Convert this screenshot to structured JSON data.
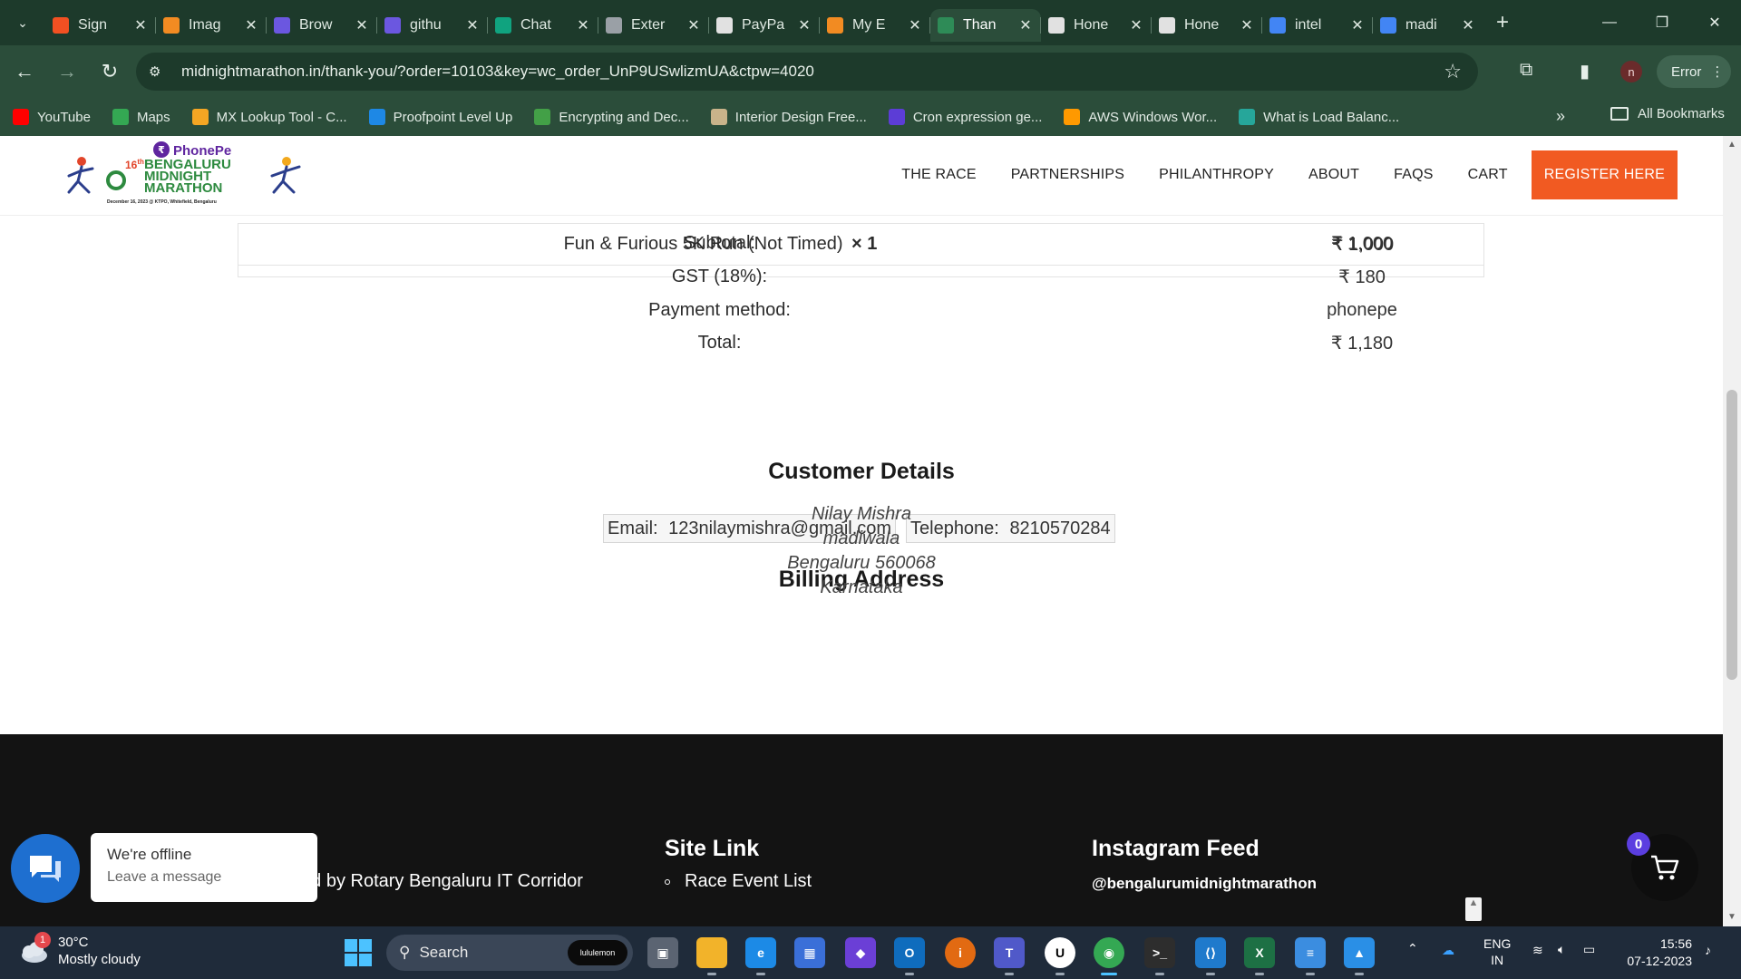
{
  "browser": {
    "tabs": [
      {
        "label": "Sign",
        "color": "#f25022"
      },
      {
        "label": "Imag",
        "color": "#f28b22"
      },
      {
        "label": "Brow",
        "color": "#6b57e0"
      },
      {
        "label": "githu",
        "color": "#6b57e0"
      },
      {
        "label": "Chat",
        "color": "#10a37f"
      },
      {
        "label": "Exter",
        "color": "#9aa0a6"
      },
      {
        "label": "PayPa",
        "color": "#e1e1e1"
      },
      {
        "label": "My E",
        "color": "#f28b22"
      },
      {
        "label": "Than",
        "color": "#2e8b57"
      },
      {
        "label": "Hone",
        "color": "#e1e1e1"
      },
      {
        "label": "Hone",
        "color": "#e1e1e1"
      },
      {
        "label": "intel",
        "color": "#4285f4"
      },
      {
        "label": "madi",
        "color": "#4285f4"
      }
    ],
    "url": "midnightmarathon.in/thank-you/?order=10103&key=wc_order_UnP9USwlizmUA&ctpw=4020",
    "profile_initial": "n",
    "error_label": "Error",
    "bookmarks": [
      {
        "label": "YouTube",
        "color": "#ff0000"
      },
      {
        "label": "Maps",
        "color": "#34a853"
      },
      {
        "label": "MX Lookup Tool - C...",
        "color": "#f5a623"
      },
      {
        "label": "Proofpoint Level Up",
        "color": "#1e88e5"
      },
      {
        "label": "Encrypting and Dec...",
        "color": "#43a047"
      },
      {
        "label": "Interior Design Free...",
        "color": "#c9b38a"
      },
      {
        "label": "Cron expression ge...",
        "color": "#5c3dd6"
      },
      {
        "label": "AWS Windows Wor...",
        "color": "#ff9900"
      },
      {
        "label": "What is Load Balanc...",
        "color": "#26a69a"
      }
    ],
    "all_bookmarks": "All Bookmarks"
  },
  "site": {
    "logo": {
      "sponsor": "PhonePe",
      "edition": "16",
      "edition_suffix": "th",
      "line1": "BENGALURU",
      "line2": "MIDNIGHT",
      "line3": "MARATHON",
      "tagline": "December 16, 2023 @ KTPO, Whitefield, Bengaluru"
    },
    "nav": [
      "THE RACE",
      "PARTNERSHIPS",
      "PHILANTHROPY",
      "ABOUT",
      "FAQS",
      "CART"
    ],
    "register_label": "REGISTER HERE",
    "accent": "#f15a22"
  },
  "order": {
    "item_name": "Fun & Furious 5K Run (Not Timed)",
    "item_qty": "× 1",
    "item_total": "₹ 1,000",
    "totals": [
      {
        "label": "Subtotal:",
        "value": "₹ 1,000"
      },
      {
        "label": "GST (18%):",
        "value": "₹ 180"
      },
      {
        "label": "Payment method:",
        "value": "phonepe"
      },
      {
        "label": "Total:",
        "value": "₹ 1,180"
      }
    ]
  },
  "customer": {
    "title": "Customer Details",
    "email_label": "Email:",
    "email": "123nilaymishra@gmail.com",
    "phone_label": "Telephone:",
    "phone": "8210570284"
  },
  "billing": {
    "title": "Billing Address",
    "lines": [
      "Nilay Mishra",
      "madiwala",
      "Bengaluru 560068",
      "Karnataka"
    ]
  },
  "footer": {
    "organiser": "Organised by Rotary Bengaluru IT Corridor",
    "site_link_title": "Site Link",
    "site_links": [
      "Race Event List"
    ],
    "instagram_title": "Instagram Feed",
    "instagram_handle": "@bengalurumidnightmarathon"
  },
  "chat_widget": {
    "status": "We're offline",
    "cta": "Leave a message"
  },
  "cart_count": "0",
  "taskbar": {
    "temperature": "30°C",
    "weather": "Mostly cloudy",
    "weather_badge": "1",
    "search_placeholder": "Search",
    "search_badge": "lululemon",
    "lang_top": "ENG",
    "lang_bottom": "IN",
    "time": "15:56",
    "date": "07-12-2023"
  }
}
